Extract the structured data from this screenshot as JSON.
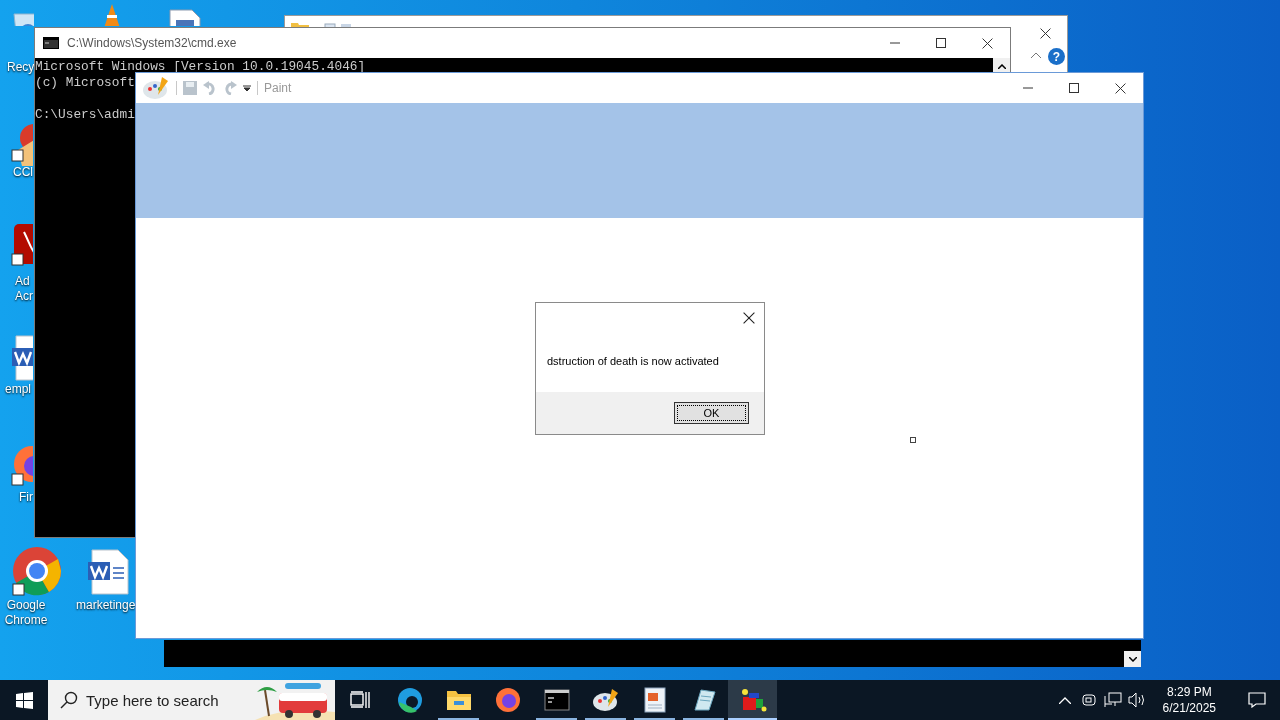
{
  "desktop_icons": [
    {
      "kind": "recycle",
      "lines": [
        "Recy"
      ]
    },
    {
      "kind": "cone"
    },
    {
      "kind": "document"
    },
    {
      "kind": "cleaner",
      "lines": [
        "CCl"
      ]
    },
    {
      "kind": "acrobat",
      "lines": [
        "Ad",
        "Acr"
      ]
    },
    {
      "kind": "word",
      "lines": [
        "empl"
      ]
    },
    {
      "kind": "firefox",
      "lines": [
        "Fir"
      ]
    },
    {
      "kind": "chrome",
      "lines": [
        "Google",
        "Chrome"
      ]
    },
    {
      "kind": "word",
      "lines": [
        "marketinge"
      ]
    }
  ],
  "cmd_window": {
    "title": "C:\\Windows\\System32\\cmd.exe",
    "paragraphs": [
      [
        "Microsoft Windows [Version 10.0.19045.4046]",
        "(c) Microsoft"
      ],
      [
        "C:\\Users\\admi"
      ]
    ]
  },
  "explorer_window": {
    "help_label": "?"
  },
  "paint_window": {
    "title": "Paint"
  },
  "dialog": {
    "message": "dstruction of death is now activated",
    "button": "OK"
  },
  "taskbar": {
    "search_placeholder": "Type here to search",
    "apps": [
      {
        "kind": "edge",
        "running": false,
        "selected": false
      },
      {
        "kind": "folder",
        "running": true,
        "selected": false
      },
      {
        "kind": "firefox",
        "running": false,
        "selected": false
      },
      {
        "kind": "console",
        "running": true,
        "selected": false
      },
      {
        "kind": "palette",
        "running": true,
        "selected": false
      },
      {
        "kind": "document",
        "running": true,
        "selected": false
      },
      {
        "kind": "notepad",
        "running": true,
        "selected": false
      },
      {
        "kind": "cubes",
        "running": true,
        "selected": true
      }
    ],
    "time": "8:29 PM",
    "date": "6/21/2025"
  }
}
